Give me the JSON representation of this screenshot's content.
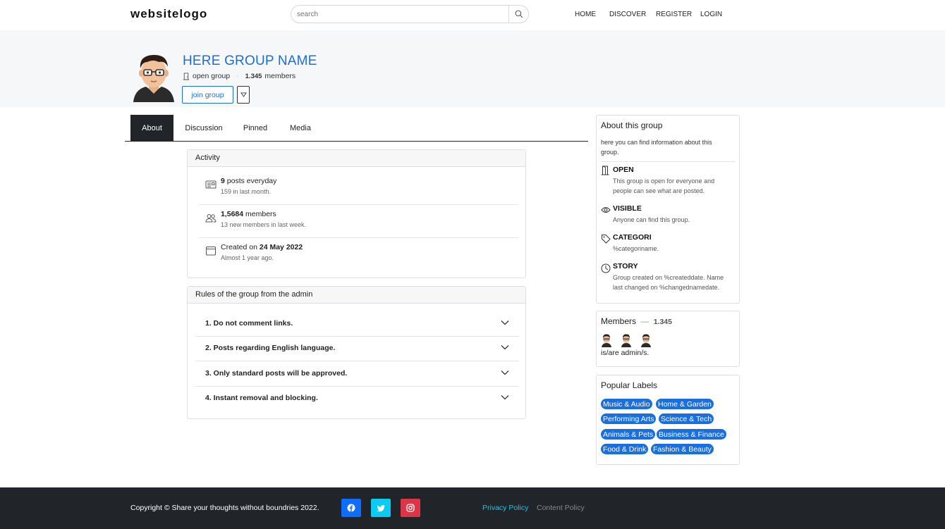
{
  "header": {
    "logo": "websitelogo",
    "search_placeholder": "search",
    "nav": [
      "HOME",
      "DISCOVER",
      "REGISTER",
      "LOGIN"
    ]
  },
  "group": {
    "name": "HERE GROUP NAME",
    "type": "open group",
    "members_count": "1.345",
    "members_label": "members",
    "join_label": "join group"
  },
  "tabs": [
    "About",
    "Discussion",
    "Pinned",
    "Media"
  ],
  "activity": {
    "title": "Activity",
    "posts_count": "9",
    "posts_label": "posts everyday",
    "posts_sub": "159 in last month.",
    "members_count": "1,5684",
    "members_label": "members",
    "members_sub": "13 new members in last week.",
    "created_prefix": "Created on",
    "created_date": "24 May 2022",
    "created_sub": "Almost 1 year ago."
  },
  "rules": {
    "title": "Rules of the group from the admin",
    "items": [
      "1. Do not comment links.",
      "2. Posts regarding English language.",
      "3. Only standard posts will be approved.",
      "4. Instant removal and blocking."
    ]
  },
  "about": {
    "title": "About this group",
    "intro": "here you can find information about this group.",
    "open_title": "OPEN",
    "open_desc": "This group is open for everyone and people can see what are posted.",
    "visible_title": "VISIBLE",
    "visible_desc": "Anyone can find this group.",
    "category_title": "CATEGORI",
    "category_desc": "%categoriname.",
    "story_title": "STORY",
    "story_desc": "Group created on %createddate. Name last changed on %changednamedate."
  },
  "members_box": {
    "title": "Members",
    "dash": "—",
    "count": "1.345",
    "admin_note": "is/are admin/s."
  },
  "labels": {
    "title": "Popular Labels",
    "items": [
      "Music & Audio",
      "Home & Garden",
      "Performing Arts",
      "Science & Tech",
      "Animals & Pets",
      "Business & Finance",
      "Food & Drink",
      "Fashion & Beauty"
    ]
  },
  "footer": {
    "copyright": "Copyright © Share your thoughts without boundries 2022.",
    "privacy": "Privacy Policy",
    "content": "Content Policy"
  },
  "colors": {
    "accent": "#1a6fe0",
    "dark": "#212529",
    "facebook": "#0d6efd",
    "twitter": "#0dcaf0",
    "instagram": "#dc3545"
  },
  "icons": [
    "search-icon",
    "door-icon",
    "newspaper-icon",
    "people-icon",
    "calendar-icon",
    "eye-icon",
    "tag-icon",
    "clock-icon",
    "chevron-down-icon",
    "facebook-icon",
    "twitter-icon",
    "instagram-icon"
  ]
}
